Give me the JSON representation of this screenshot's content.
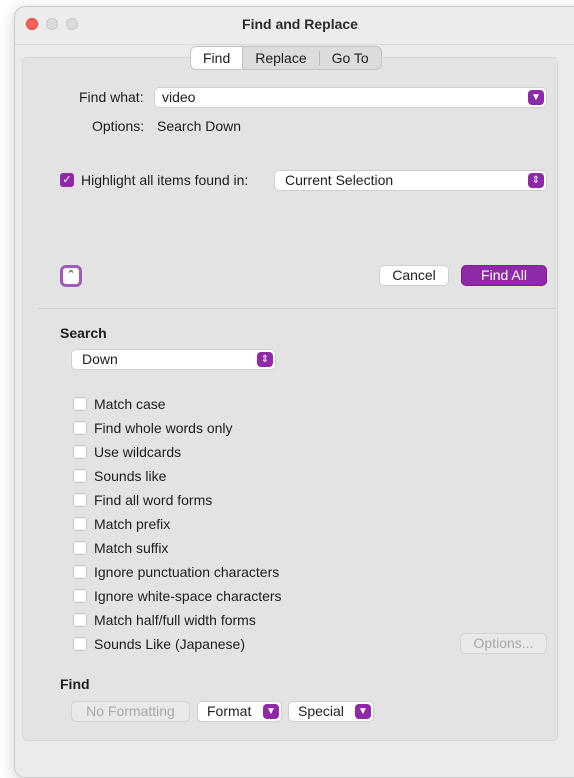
{
  "window": {
    "title": "Find and Replace"
  },
  "tabs": [
    "Find",
    "Replace",
    "Go To"
  ],
  "find_what": {
    "label": "Find what:",
    "value": "video"
  },
  "options": {
    "label": "Options:",
    "value": "Search Down"
  },
  "highlight": {
    "label": "Highlight all items found in:",
    "checked": true,
    "selection": "Current Selection"
  },
  "buttons": {
    "cancel": "Cancel",
    "find_all": "Find All"
  },
  "search": {
    "heading": "Search",
    "direction": "Down"
  },
  "checkboxes": [
    "Match case",
    "Find whole words only",
    "Use wildcards",
    "Sounds like",
    "Find all word forms",
    "Match prefix",
    "Match suffix",
    "Ignore punctuation characters",
    "Ignore white-space characters",
    "Match half/full width forms",
    "Sounds Like (Japanese)"
  ],
  "options_button": "Options...",
  "find_section": {
    "heading": "Find",
    "no_formatting": "No Formatting",
    "format": "Format",
    "special": "Special"
  },
  "colors": {
    "accent": "#8e29a8"
  },
  "icons": {
    "popup_arrow": "chevron-down-icon",
    "stepper": "up-down-chevron-icon",
    "collapse": "chevron-up-icon",
    "check": "checkmark-icon"
  }
}
